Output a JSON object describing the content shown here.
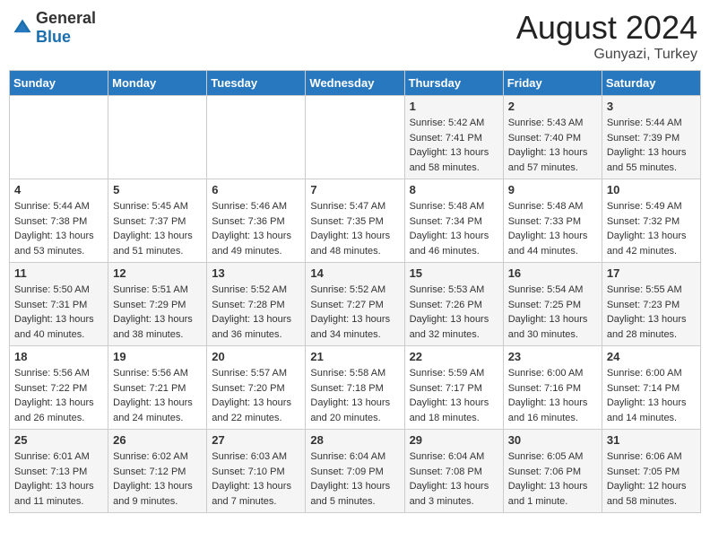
{
  "header": {
    "logo_general": "General",
    "logo_blue": "Blue",
    "month_year": "August 2024",
    "location": "Gunyazi, Turkey"
  },
  "days_of_week": [
    "Sunday",
    "Monday",
    "Tuesday",
    "Wednesday",
    "Thursday",
    "Friday",
    "Saturday"
  ],
  "weeks": [
    [
      {
        "day": "",
        "sunrise": "",
        "sunset": "",
        "daylight": ""
      },
      {
        "day": "",
        "sunrise": "",
        "sunset": "",
        "daylight": ""
      },
      {
        "day": "",
        "sunrise": "",
        "sunset": "",
        "daylight": ""
      },
      {
        "day": "",
        "sunrise": "",
        "sunset": "",
        "daylight": ""
      },
      {
        "day": "1",
        "sunrise": "Sunrise: 5:42 AM",
        "sunset": "Sunset: 7:41 PM",
        "daylight": "Daylight: 13 hours and 58 minutes."
      },
      {
        "day": "2",
        "sunrise": "Sunrise: 5:43 AM",
        "sunset": "Sunset: 7:40 PM",
        "daylight": "Daylight: 13 hours and 57 minutes."
      },
      {
        "day": "3",
        "sunrise": "Sunrise: 5:44 AM",
        "sunset": "Sunset: 7:39 PM",
        "daylight": "Daylight: 13 hours and 55 minutes."
      }
    ],
    [
      {
        "day": "4",
        "sunrise": "Sunrise: 5:44 AM",
        "sunset": "Sunset: 7:38 PM",
        "daylight": "Daylight: 13 hours and 53 minutes."
      },
      {
        "day": "5",
        "sunrise": "Sunrise: 5:45 AM",
        "sunset": "Sunset: 7:37 PM",
        "daylight": "Daylight: 13 hours and 51 minutes."
      },
      {
        "day": "6",
        "sunrise": "Sunrise: 5:46 AM",
        "sunset": "Sunset: 7:36 PM",
        "daylight": "Daylight: 13 hours and 49 minutes."
      },
      {
        "day": "7",
        "sunrise": "Sunrise: 5:47 AM",
        "sunset": "Sunset: 7:35 PM",
        "daylight": "Daylight: 13 hours and 48 minutes."
      },
      {
        "day": "8",
        "sunrise": "Sunrise: 5:48 AM",
        "sunset": "Sunset: 7:34 PM",
        "daylight": "Daylight: 13 hours and 46 minutes."
      },
      {
        "day": "9",
        "sunrise": "Sunrise: 5:48 AM",
        "sunset": "Sunset: 7:33 PM",
        "daylight": "Daylight: 13 hours and 44 minutes."
      },
      {
        "day": "10",
        "sunrise": "Sunrise: 5:49 AM",
        "sunset": "Sunset: 7:32 PM",
        "daylight": "Daylight: 13 hours and 42 minutes."
      }
    ],
    [
      {
        "day": "11",
        "sunrise": "Sunrise: 5:50 AM",
        "sunset": "Sunset: 7:31 PM",
        "daylight": "Daylight: 13 hours and 40 minutes."
      },
      {
        "day": "12",
        "sunrise": "Sunrise: 5:51 AM",
        "sunset": "Sunset: 7:29 PM",
        "daylight": "Daylight: 13 hours and 38 minutes."
      },
      {
        "day": "13",
        "sunrise": "Sunrise: 5:52 AM",
        "sunset": "Sunset: 7:28 PM",
        "daylight": "Daylight: 13 hours and 36 minutes."
      },
      {
        "day": "14",
        "sunrise": "Sunrise: 5:52 AM",
        "sunset": "Sunset: 7:27 PM",
        "daylight": "Daylight: 13 hours and 34 minutes."
      },
      {
        "day": "15",
        "sunrise": "Sunrise: 5:53 AM",
        "sunset": "Sunset: 7:26 PM",
        "daylight": "Daylight: 13 hours and 32 minutes."
      },
      {
        "day": "16",
        "sunrise": "Sunrise: 5:54 AM",
        "sunset": "Sunset: 7:25 PM",
        "daylight": "Daylight: 13 hours and 30 minutes."
      },
      {
        "day": "17",
        "sunrise": "Sunrise: 5:55 AM",
        "sunset": "Sunset: 7:23 PM",
        "daylight": "Daylight: 13 hours and 28 minutes."
      }
    ],
    [
      {
        "day": "18",
        "sunrise": "Sunrise: 5:56 AM",
        "sunset": "Sunset: 7:22 PM",
        "daylight": "Daylight: 13 hours and 26 minutes."
      },
      {
        "day": "19",
        "sunrise": "Sunrise: 5:56 AM",
        "sunset": "Sunset: 7:21 PM",
        "daylight": "Daylight: 13 hours and 24 minutes."
      },
      {
        "day": "20",
        "sunrise": "Sunrise: 5:57 AM",
        "sunset": "Sunset: 7:20 PM",
        "daylight": "Daylight: 13 hours and 22 minutes."
      },
      {
        "day": "21",
        "sunrise": "Sunrise: 5:58 AM",
        "sunset": "Sunset: 7:18 PM",
        "daylight": "Daylight: 13 hours and 20 minutes."
      },
      {
        "day": "22",
        "sunrise": "Sunrise: 5:59 AM",
        "sunset": "Sunset: 7:17 PM",
        "daylight": "Daylight: 13 hours and 18 minutes."
      },
      {
        "day": "23",
        "sunrise": "Sunrise: 6:00 AM",
        "sunset": "Sunset: 7:16 PM",
        "daylight": "Daylight: 13 hours and 16 minutes."
      },
      {
        "day": "24",
        "sunrise": "Sunrise: 6:00 AM",
        "sunset": "Sunset: 7:14 PM",
        "daylight": "Daylight: 13 hours and 14 minutes."
      }
    ],
    [
      {
        "day": "25",
        "sunrise": "Sunrise: 6:01 AM",
        "sunset": "Sunset: 7:13 PM",
        "daylight": "Daylight: 13 hours and 11 minutes."
      },
      {
        "day": "26",
        "sunrise": "Sunrise: 6:02 AM",
        "sunset": "Sunset: 7:12 PM",
        "daylight": "Daylight: 13 hours and 9 minutes."
      },
      {
        "day": "27",
        "sunrise": "Sunrise: 6:03 AM",
        "sunset": "Sunset: 7:10 PM",
        "daylight": "Daylight: 13 hours and 7 minutes."
      },
      {
        "day": "28",
        "sunrise": "Sunrise: 6:04 AM",
        "sunset": "Sunset: 7:09 PM",
        "daylight": "Daylight: 13 hours and 5 minutes."
      },
      {
        "day": "29",
        "sunrise": "Sunrise: 6:04 AM",
        "sunset": "Sunset: 7:08 PM",
        "daylight": "Daylight: 13 hours and 3 minutes."
      },
      {
        "day": "30",
        "sunrise": "Sunrise: 6:05 AM",
        "sunset": "Sunset: 7:06 PM",
        "daylight": "Daylight: 13 hours and 1 minute."
      },
      {
        "day": "31",
        "sunrise": "Sunrise: 6:06 AM",
        "sunset": "Sunset: 7:05 PM",
        "daylight": "Daylight: 12 hours and 58 minutes."
      }
    ]
  ]
}
